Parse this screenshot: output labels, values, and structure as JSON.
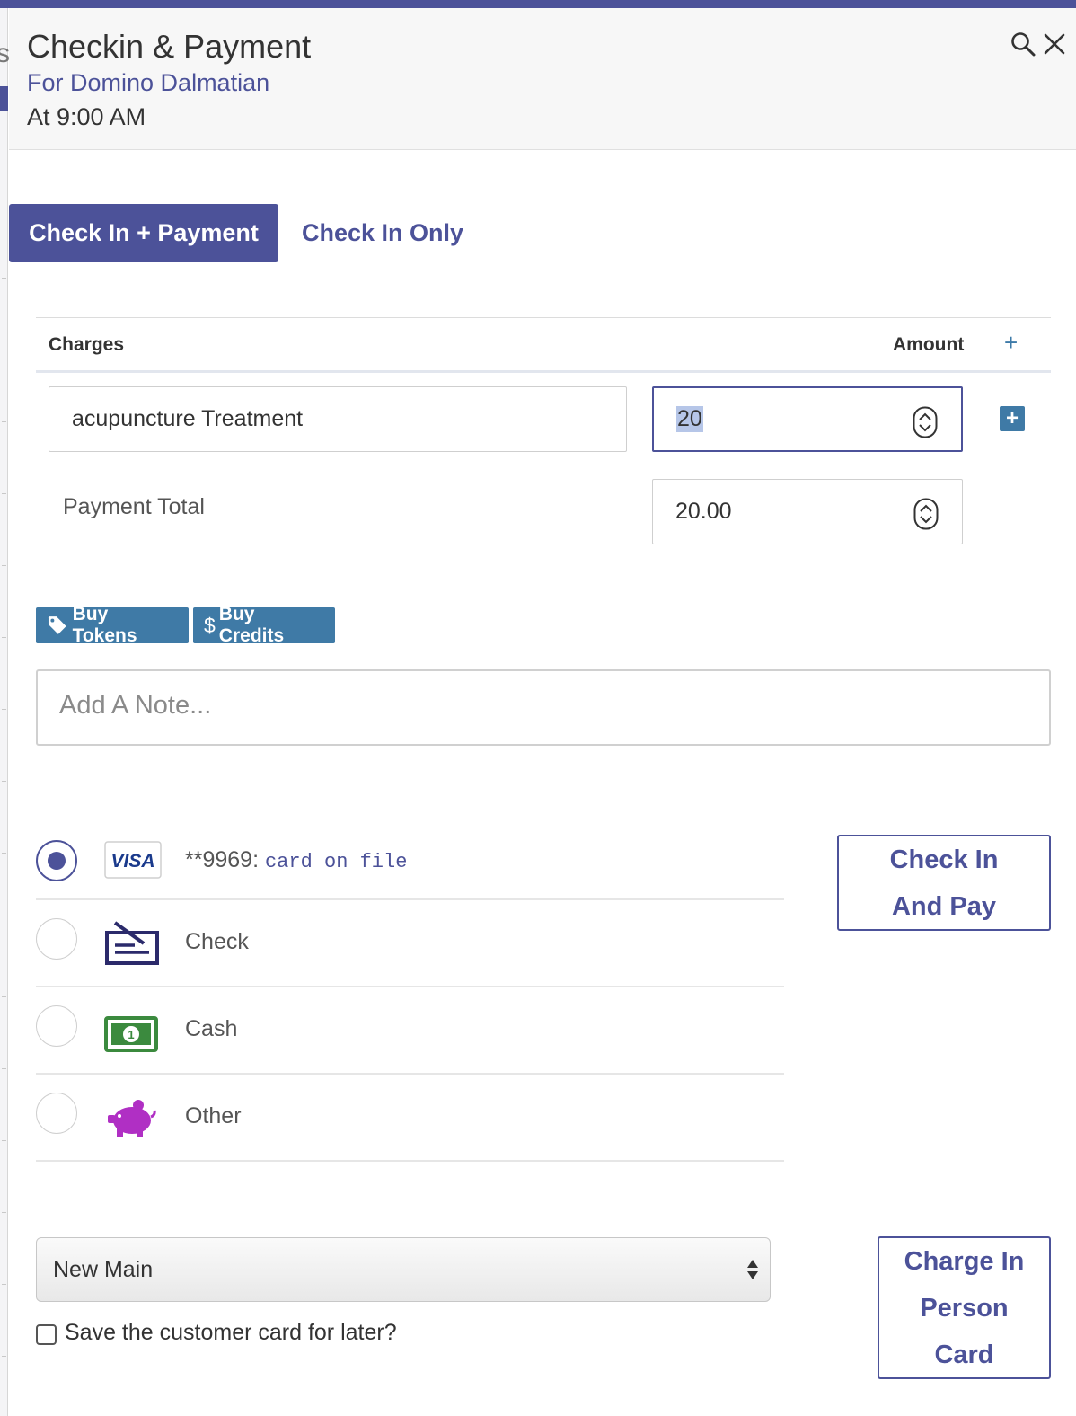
{
  "header": {
    "title": "Checkin & Payment",
    "for_prefix": "For",
    "customer_name": "Domino Dalmatian",
    "time_text": "At 9:00 AM"
  },
  "tabs": {
    "active": "Check In + Payment",
    "inactive": "Check In Only"
  },
  "charges": {
    "header_charges": "Charges",
    "header_amount": "Amount",
    "add_link": "+",
    "rows": [
      {
        "description": "acupuncture Treatment",
        "amount": "20"
      }
    ],
    "add_button": "+",
    "payment_total_label": "Payment Total",
    "payment_total_value": "20.00"
  },
  "buttons": {
    "buy_tokens": "Buy Tokens",
    "buy_credits": "Buy Credits",
    "credits_symbol": "$",
    "check_in_and_pay_line1": "Check In",
    "check_in_and_pay_line2": "And Pay",
    "charge_line1": "Charge In",
    "charge_line2": "Person",
    "charge_line3": "Card"
  },
  "note": {
    "placeholder": "Add A Note..."
  },
  "payment_methods": [
    {
      "label": "**9969:",
      "detail": "card on file",
      "selected": true,
      "icon": "visa-card-icon",
      "card_brand": "VISA"
    },
    {
      "label": "Check",
      "selected": false,
      "icon": "check-icon"
    },
    {
      "label": "Cash",
      "selected": false,
      "icon": "cash-icon"
    },
    {
      "label": "Other",
      "selected": false,
      "icon": "piggy-bank-icon"
    }
  ],
  "footer": {
    "location_select": "New Main",
    "save_card_label": "Save the customer card for later?"
  },
  "colors": {
    "brand": "#4c5299",
    "badge": "#3f7aa6",
    "cash_green": "#3b8a3e",
    "other_purple": "#b02fc4",
    "check_navy": "#2b2a6b"
  }
}
